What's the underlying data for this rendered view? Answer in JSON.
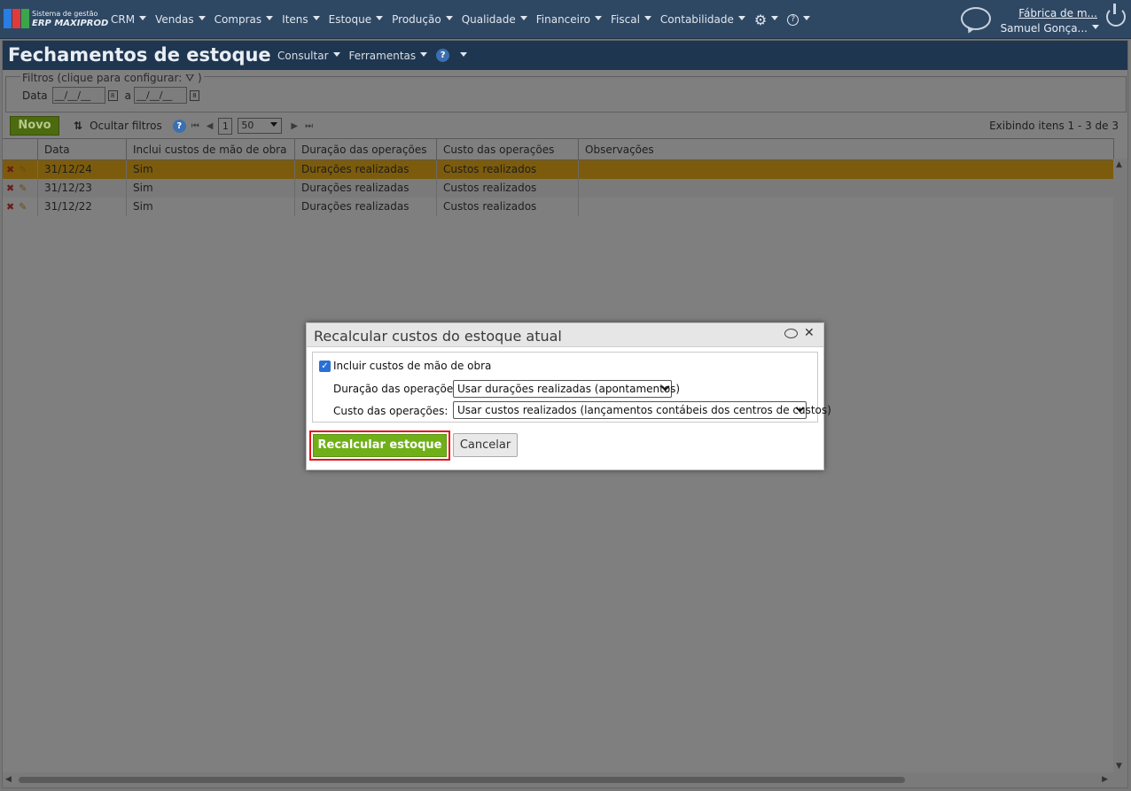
{
  "topbar": {
    "logo_line1": "Sistema de gestão",
    "logo_line2": "ERP MAXIPROD",
    "menu": [
      "CRM",
      "Vendas",
      "Compras",
      "Itens",
      "Estoque",
      "Produção",
      "Qualidade",
      "Financeiro",
      "Fiscal",
      "Contabilidade"
    ],
    "company": "Fábrica de m...",
    "user": "Samuel Gonça..."
  },
  "page": {
    "title": "Fechamentos de estoque",
    "header_menu": {
      "consultar": "Consultar",
      "ferramentas": "Ferramentas"
    },
    "filters": {
      "legend": "Filtros (clique para configurar:",
      "date_label": "Data",
      "from": "__/__/__",
      "to_label": "a",
      "to": "__/__/__"
    },
    "toolbar": {
      "novo": "Novo",
      "hide_filters": "Ocultar filtros",
      "page": "1",
      "page_size": "50",
      "showing": "Exibindo itens 1 - 3 de 3"
    },
    "grid": {
      "columns": [
        "Data",
        "Inclui custos de mão de obra",
        "Duração das operações",
        "Custo das operações",
        "Observações"
      ],
      "rows": [
        {
          "data": "31/12/24",
          "inclui": "Sim",
          "duracao": "Durações realizadas",
          "custo": "Custos realizados",
          "obs": ""
        },
        {
          "data": "31/12/23",
          "inclui": "Sim",
          "duracao": "Durações realizadas",
          "custo": "Custos realizados",
          "obs": ""
        },
        {
          "data": "31/12/22",
          "inclui": "Sim",
          "duracao": "Durações realizadas",
          "custo": "Custos realizados",
          "obs": ""
        }
      ]
    }
  },
  "dialog": {
    "title": "Recalcular custos do estoque atual",
    "checkbox_label": "Incluir custos de mão de obra",
    "checkbox_checked": true,
    "duracao_label": "Duração das operações:",
    "duracao_value": "Usar durações realizadas (apontamentos)",
    "custo_label": "Custo das operações:",
    "custo_value": "Usar custos realizados (lançamentos contábeis dos centros de custos)",
    "recalc_button": "Recalcular estoque",
    "cancel_button": "Cancelar"
  },
  "colors": {
    "accent_green": "#6fb019",
    "nav_bg": "#2e4763",
    "highlight": "#e3151a"
  }
}
